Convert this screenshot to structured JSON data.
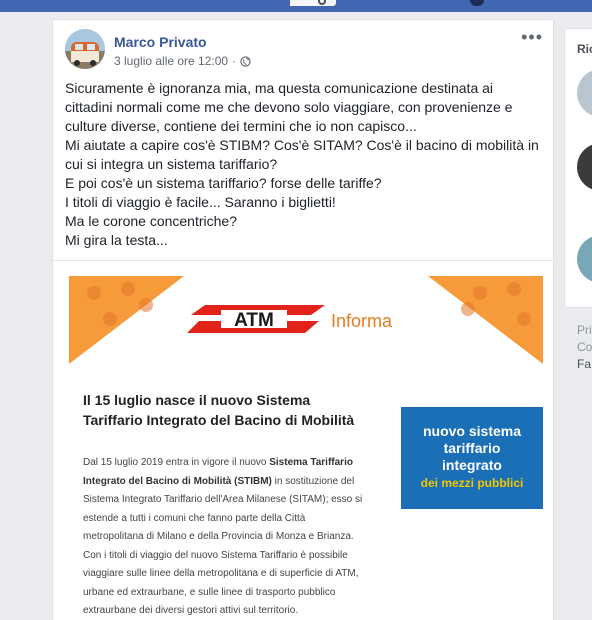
{
  "post": {
    "author": "Marco Privato",
    "timestamp": "3 luglio alle ore 12:00",
    "privacy_separator": "·",
    "more_label": "•••",
    "text_lines": [
      "Sicuramente è ignoranza mia, ma questa comunicazione destinata ai",
      "cittadini normali come me che devono solo viaggiare, con provenienze e",
      "culture diverse, contiene dei termini che io non capisco...",
      "Mi aiutate a capire cos'è STIBM? Cos'è SITAM? Cos'è il bacino di mobilità in",
      "cui si integra un sistema tariffario?",
      "E poi cos'è un sistema tariffario? forse delle tariffe?",
      "I titoli di viaggio è facile... Saranno i biglietti!",
      "Ma le corone concentriche?",
      "Mi gira la testa..."
    ]
  },
  "shared_image": {
    "logo_text": "ATM",
    "informa": "Informa",
    "headline_1": "Il 15 luglio nasce il nuovo Sistema",
    "headline_2": "Tariffario Integrato del Bacino di Mobilità",
    "body": [
      {
        "pre": "Dal 15 luglio 2019 entra in vigore il nuovo ",
        "bold": "Sistema Tariffario",
        "post": ""
      },
      {
        "pre": "",
        "bold": "Integrato del Bacino di Mobilità (STIBM)",
        "post": " in sostituzione del"
      },
      {
        "pre": "Sistema Integrato Tariffario dell'Area Milanese (SITAM); esso si",
        "bold": "",
        "post": ""
      },
      {
        "pre": "estende a tutti i comuni che fanno parte della Città",
        "bold": "",
        "post": ""
      },
      {
        "pre": "metropolitana di Milano e della Provincia di Monza e Brianza.",
        "bold": "",
        "post": ""
      },
      {
        "pre": "Con i titoli di viaggio del nuovo Sistema Tariffario è possibile",
        "bold": "",
        "post": ""
      },
      {
        "pre": "viaggiare sulle linee della metropolitana e di superficie di ATM,",
        "bold": "",
        "post": ""
      },
      {
        "pre": "urbane ed extraurbane, e sulle linee di trasporto pubblico",
        "bold": "",
        "post": ""
      },
      {
        "pre": "extraurbane dei diversi gestori attivi sul territorio.",
        "bold": "",
        "post": ""
      }
    ],
    "badge_lines": [
      "nuovo sistema",
      "tariffario",
      "integrato",
      "dei mezzi pubblici"
    ]
  },
  "right_column": {
    "title": "Ric",
    "links": [
      "Pri",
      "Co",
      "Fa"
    ]
  },
  "colors": {
    "facebook_blue": "#4267b2",
    "link_blue": "#385898",
    "atm_orange": "#f79a3a",
    "atm_red": "#e2231a",
    "badge_blue": "#1a6fb7",
    "badge_yellow": "#f2c700"
  }
}
